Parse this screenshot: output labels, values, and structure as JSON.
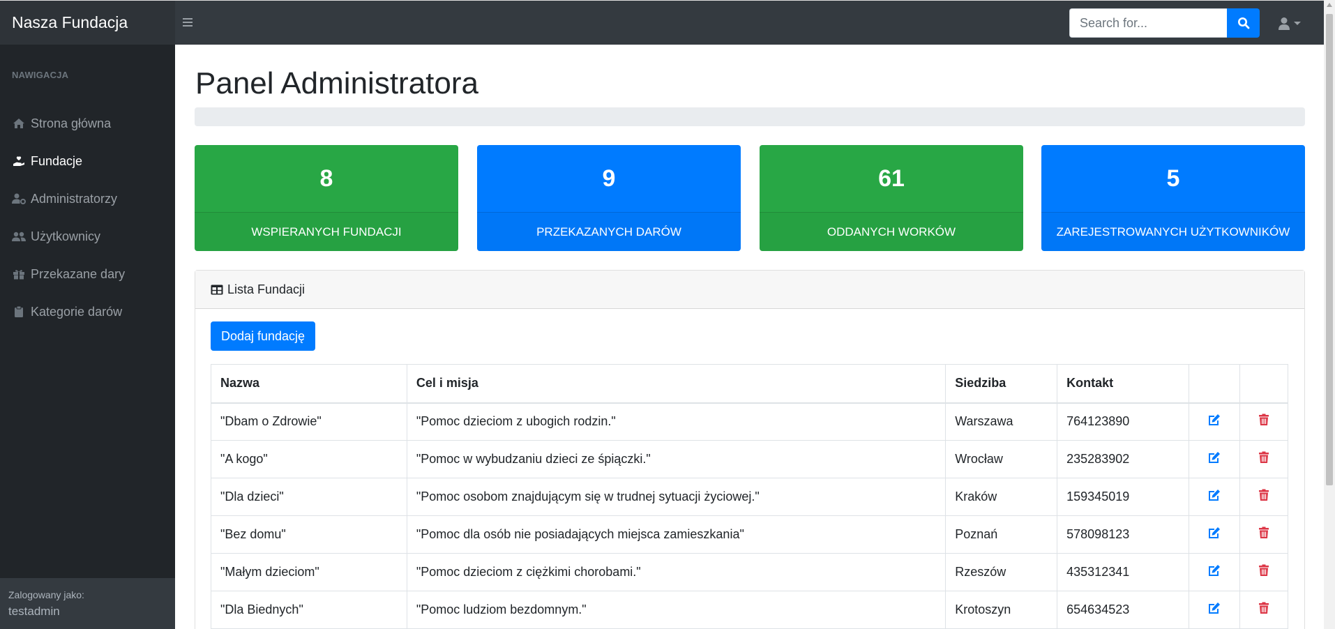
{
  "brand": "Nasza Fundacja",
  "search": {
    "placeholder": "Search for..."
  },
  "sidebar": {
    "header": "NAWIGACJA",
    "items": [
      {
        "label": "Strona główna",
        "icon": "home-icon",
        "active": false
      },
      {
        "label": "Fundacje",
        "icon": "hand-holding-heart-icon",
        "active": true
      },
      {
        "label": "Administratorzy",
        "icon": "user-cog-icon",
        "active": false
      },
      {
        "label": "Użytkownicy",
        "icon": "users-icon",
        "active": false
      },
      {
        "label": "Przekazane dary",
        "icon": "gift-icon",
        "active": false
      },
      {
        "label": "Kategorie darów",
        "icon": "clipboard-icon",
        "active": false
      }
    ],
    "footer": {
      "label": "Zalogowany jako:",
      "user": "testadmin"
    }
  },
  "main": {
    "title": "Panel Administratora",
    "stats": [
      {
        "value": "8",
        "label": "WSPIERANYCH FUNDACJI",
        "color": "#28a745"
      },
      {
        "value": "9",
        "label": "PRZEKAZANYCH DARÓW",
        "color": "#007bff"
      },
      {
        "value": "61",
        "label": "ODDANYCH WORKÓW",
        "color": "#28a745"
      },
      {
        "value": "5",
        "label": "ZAREJESTROWANYCH UŻYTKOWNIKÓW",
        "color": "#007bff"
      }
    ],
    "card": {
      "title": "Lista Fundacji",
      "add_button": "Dodaj fundację",
      "columns": [
        "Nazwa",
        "Cel i misja",
        "Siedziba",
        "Kontakt",
        "",
        ""
      ],
      "rows": [
        {
          "name": "\"Dbam o Zdrowie\"",
          "mission": "\"Pomoc dzieciom z ubogich rodzin.\"",
          "city": "Warszawa",
          "contact": "764123890"
        },
        {
          "name": "\"A kogo\"",
          "mission": "\"Pomoc w wybudzaniu dzieci ze śpiączki.\"",
          "city": "Wrocław",
          "contact": "235283902"
        },
        {
          "name": "\"Dla dzieci\"",
          "mission": "\"Pomoc osobom znajdującym się w trudnej sytuacji życiowej.\"",
          "city": "Kraków",
          "contact": "159345019"
        },
        {
          "name": "\"Bez domu\"",
          "mission": "\"Pomoc dla osób nie posiadających miejsca zamieszkania\"",
          "city": "Poznań",
          "contact": "578098123"
        },
        {
          "name": "\"Małym dzieciom\"",
          "mission": "\"Pomoc dzieciom z ciężkimi chorobami.\"",
          "city": "Rzeszów",
          "contact": "435312341"
        },
        {
          "name": "\"Dla Biednych\"",
          "mission": "\"Pomoc ludziom bezdomnym.\"",
          "city": "Krotoszyn",
          "contact": "654634523"
        }
      ]
    }
  },
  "colors": {
    "accent": "#007bff",
    "success": "#28a745",
    "danger": "#dc3545",
    "navbar": "#343a40",
    "sidebar": "#212529"
  }
}
